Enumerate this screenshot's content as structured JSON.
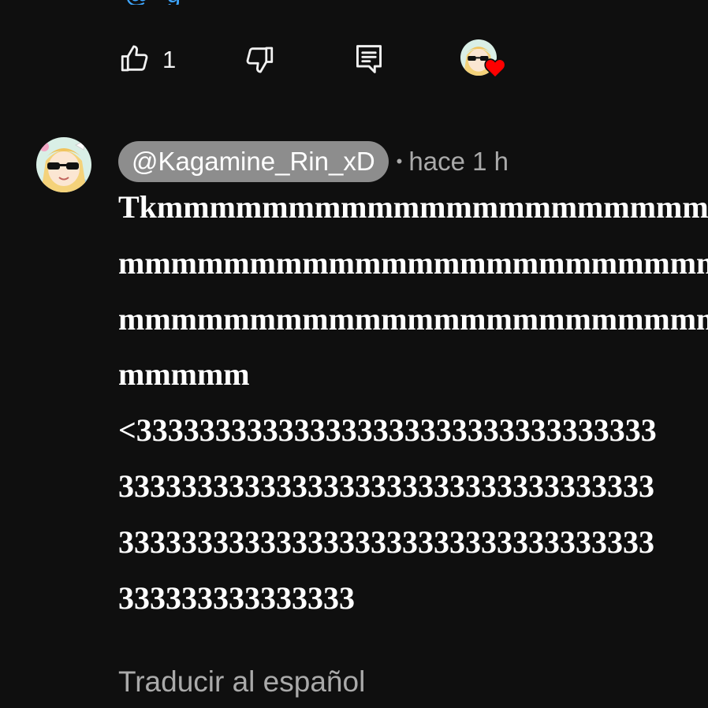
{
  "top_partial": {
    "text": "@ g"
  },
  "actions": {
    "like_count": "1",
    "like_icon": "thumbs-up-icon",
    "dislike_icon": "thumbs-down-icon",
    "reply_icon": "comment-icon",
    "creator_heart_icon": "heart-icon"
  },
  "comment": {
    "author": "@Kagamine_Rin_xD",
    "separator": "•",
    "timestamp": "hace 1 h",
    "lines": [
      "Tkmmmmmmmmmmmmmmmmmmmmm",
      "mmmmmmmmmmmmmmmmmmmmmmm",
      "mmmmmmmmmmmmmmmmmmmmmmm",
      "mmmmm",
      "<333333333333333333333333333333333",
      "3333333333333333333333333333333333",
      "3333333333333333333333333333333333",
      "333333333333333"
    ],
    "translate_label": "Traducir al español"
  },
  "colors": {
    "background": "#0f0f0f",
    "text": "#f1f1f1",
    "secondary_text": "#aaaaaa",
    "author_chip": "#8d8d8d",
    "link": "#3ea6ff",
    "heart": "#ff0000"
  }
}
